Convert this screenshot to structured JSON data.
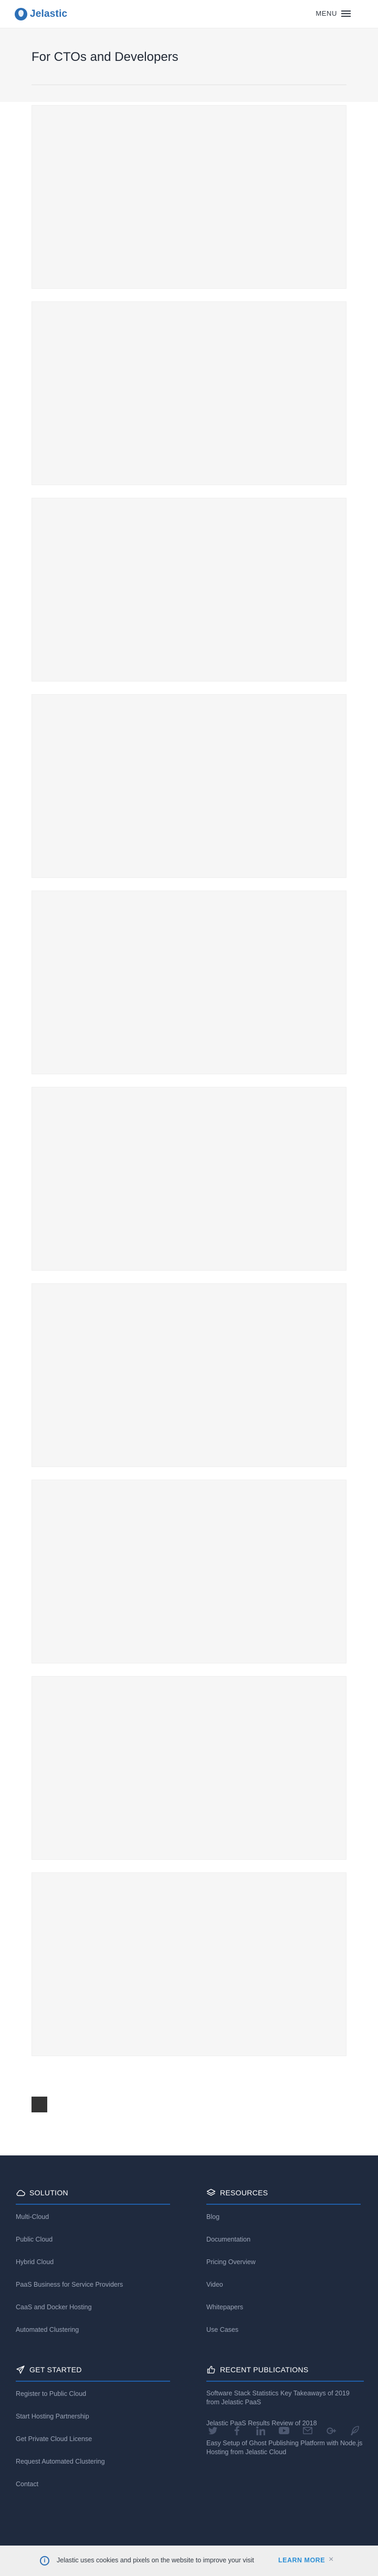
{
  "header": {
    "logo_text": "Jelastic",
    "menu_label": "MENU"
  },
  "hero": {
    "title": "For CTOs and Developers"
  },
  "footer": {
    "solution": {
      "title": "SOLUTION",
      "icon": "cloud-icon",
      "items": [
        "Multi-Cloud",
        "Public Cloud",
        "Hybrid Cloud",
        "PaaS Business for Service Providers",
        "CaaS and Docker Hosting",
        "Automated Clustering"
      ]
    },
    "resources": {
      "title": "RESOURCES",
      "icon": "layers-icon",
      "items": [
        "Blog",
        "Documentation",
        "Pricing Overview",
        "Video",
        "Whitepapers",
        "Use Cases"
      ]
    },
    "get_started": {
      "title": "GET STARTED",
      "icon": "paper-plane-icon",
      "items": [
        "Register to Public Cloud",
        "Start Hosting Partnership",
        "Get Private Cloud License",
        "Request Automated Clustering",
        "Contact"
      ]
    },
    "recent_publications": {
      "title": "RECENT PUBLICATIONS",
      "icon": "thumbs-up-icon",
      "items": [
        "Software Stack Statistics Key Takeaways of 2019 from Jelastic PaaS",
        "Jelastic PaaS Results Review of 2018",
        "Easy Setup of Ghost Publishing Platform with Node.js Hosting from Jelastic Cloud"
      ]
    },
    "social_icons": [
      "twitter-icon",
      "facebook-icon",
      "linkedin-icon",
      "youtube-icon",
      "email-icon",
      "google-plus-icon",
      "feather-icon"
    ]
  },
  "cookie": {
    "text": "Jelastic uses cookies and pixels on the website to improve your visit",
    "learn_more": "LEARN MORE",
    "close": "×"
  },
  "colors": {
    "brand": "#2c6fb6",
    "footer_bg": "#1f2a3e",
    "footer_rule": "#1f5eaa",
    "placeholder": "#f6f6f6"
  }
}
